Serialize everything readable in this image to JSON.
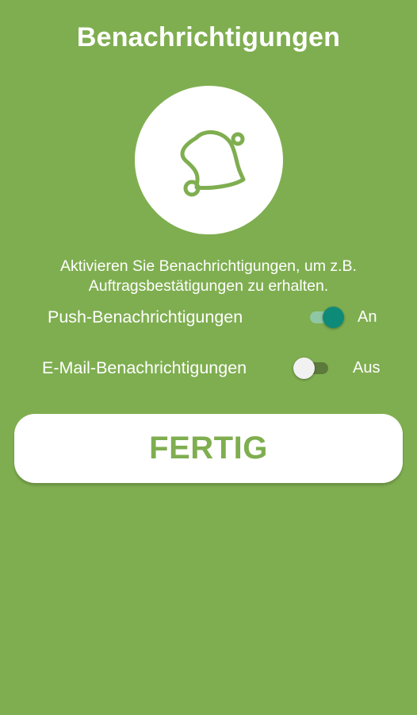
{
  "header": {
    "title": "Benachrichtigungen",
    "icon": "bell-icon"
  },
  "description": {
    "line1": "Aktivieren Sie Benachrichtigungen, um z.B.",
    "line2": "Auftragsbestätigungen zu erhalten."
  },
  "settings": [
    {
      "label": "Push-Benachrichtigungen",
      "state_text": "An",
      "enabled": true
    },
    {
      "label": "E-Mail-Benachrichtigungen",
      "state_text": "Aus",
      "enabled": false
    }
  ],
  "button": {
    "label": "FERTIG"
  },
  "colors": {
    "background": "#7fae50",
    "accent": "#0e8a78",
    "text": "#ffffff"
  }
}
